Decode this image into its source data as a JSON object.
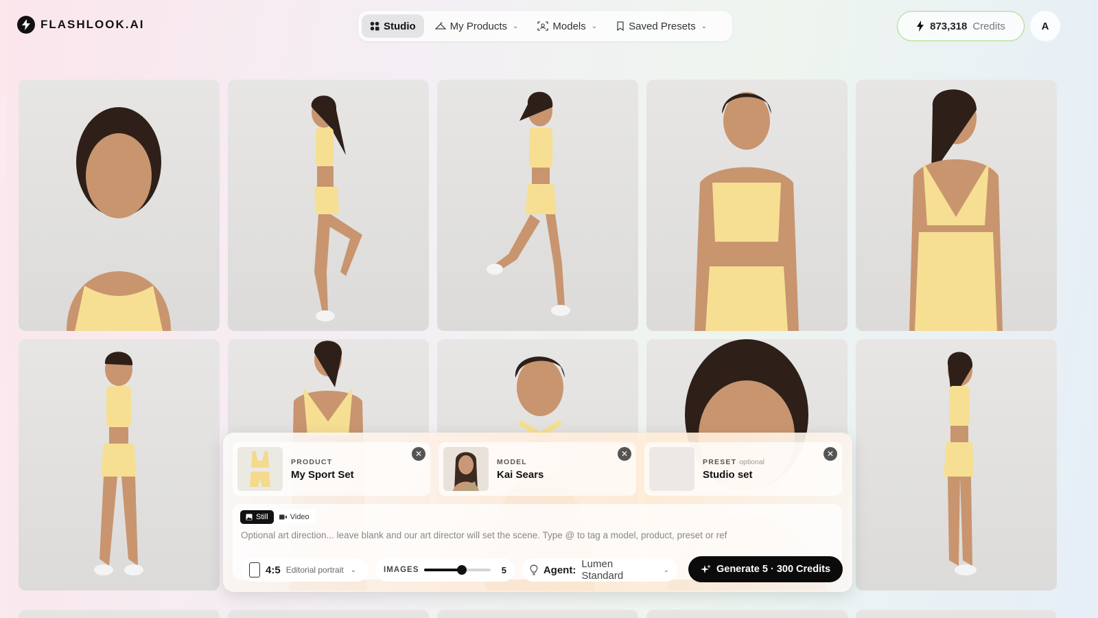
{
  "brand": {
    "name": "FLASHLOOK.AI"
  },
  "nav": {
    "items": [
      {
        "label": "Studio",
        "icon": "studio-icon",
        "active": true
      },
      {
        "label": "My Products",
        "icon": "hanger-icon",
        "dropdown": true
      },
      {
        "label": "Models",
        "icon": "face-scan-icon",
        "dropdown": true
      },
      {
        "label": "Saved Presets",
        "icon": "bookmark-icon",
        "dropdown": true
      }
    ]
  },
  "credits": {
    "amount": "873,318",
    "label": "Credits",
    "border_color": "#a7d97b"
  },
  "user": {
    "initial": "A"
  },
  "gallery": {
    "photos": [
      {
        "pose": "portrait-closeup"
      },
      {
        "pose": "side-knee-raise"
      },
      {
        "pose": "running"
      },
      {
        "pose": "front-hip"
      },
      {
        "pose": "back-over-shoulder"
      },
      {
        "pose": "full-body-front"
      },
      {
        "pose": "back-crop"
      },
      {
        "pose": "shoulder-profile"
      },
      {
        "pose": "head-down-closeup"
      },
      {
        "pose": "full-body-side"
      }
    ],
    "outfit_color": "#f6df93"
  },
  "composer": {
    "product": {
      "kind": "PRODUCT",
      "value": "My Sport Set"
    },
    "model": {
      "kind": "MODEL",
      "value": "Kai Sears"
    },
    "preset": {
      "kind": "PRESET",
      "optional": "optional",
      "value": "Studio set"
    },
    "mode": {
      "still": "Still",
      "video": "Video",
      "active": "still"
    },
    "prompt_placeholder": "Optional art direction... leave blank and our art director will set the scene. Type @ to tag a model, product, preset or ref",
    "aspect": {
      "value": "4:5",
      "label": "Editorial portrait"
    },
    "images": {
      "label": "IMAGES",
      "count": "5",
      "min": 1,
      "max": 8,
      "value": 5
    },
    "agent": {
      "key": "Agent:",
      "value": "Lumen Standard"
    },
    "generate_label": "Generate 5 · 300 Credits"
  }
}
